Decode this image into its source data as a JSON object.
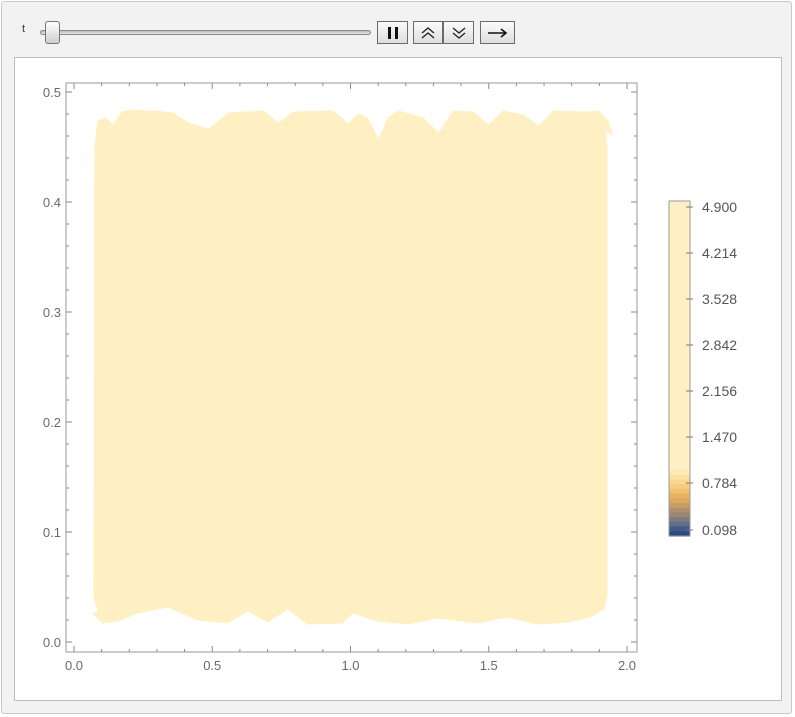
{
  "controls": {
    "slider_label": "t",
    "slider_value_fraction": 0.0,
    "buttons": [
      {
        "name": "pause-button",
        "icon": "pause-icon"
      },
      {
        "name": "faster-button",
        "icon": "chevron-double-up-icon"
      },
      {
        "name": "slower-button",
        "icon": "chevron-double-down-icon"
      },
      {
        "name": "direction-button",
        "icon": "arrow-right-icon"
      }
    ]
  },
  "chart_data": {
    "type": "contour",
    "xlim": [
      0.0,
      2.0
    ],
    "ylim": [
      0.0,
      0.5
    ],
    "xticks": [
      "0.0",
      "0.5",
      "1.0",
      "1.5",
      "2.0"
    ],
    "yticks": [
      "0.0",
      "0.1",
      "0.2",
      "0.3",
      "0.4",
      "0.5"
    ],
    "fill_color": "#fff0c4",
    "filled_region": {
      "x_range": [
        0.07,
        1.93
      ],
      "y_range": [
        0.015,
        0.485
      ]
    },
    "colorbar": {
      "labels": [
        "4.900",
        "4.214",
        "3.528",
        "2.842",
        "2.156",
        "1.470",
        "0.784",
        "0.098"
      ],
      "colors": [
        "#fff0c4",
        "#fde9b2",
        "#f6cf86",
        "#e9b063",
        "#c79a5e",
        "#8d7f78",
        "#5d6a8a",
        "#2d4a80"
      ]
    }
  }
}
